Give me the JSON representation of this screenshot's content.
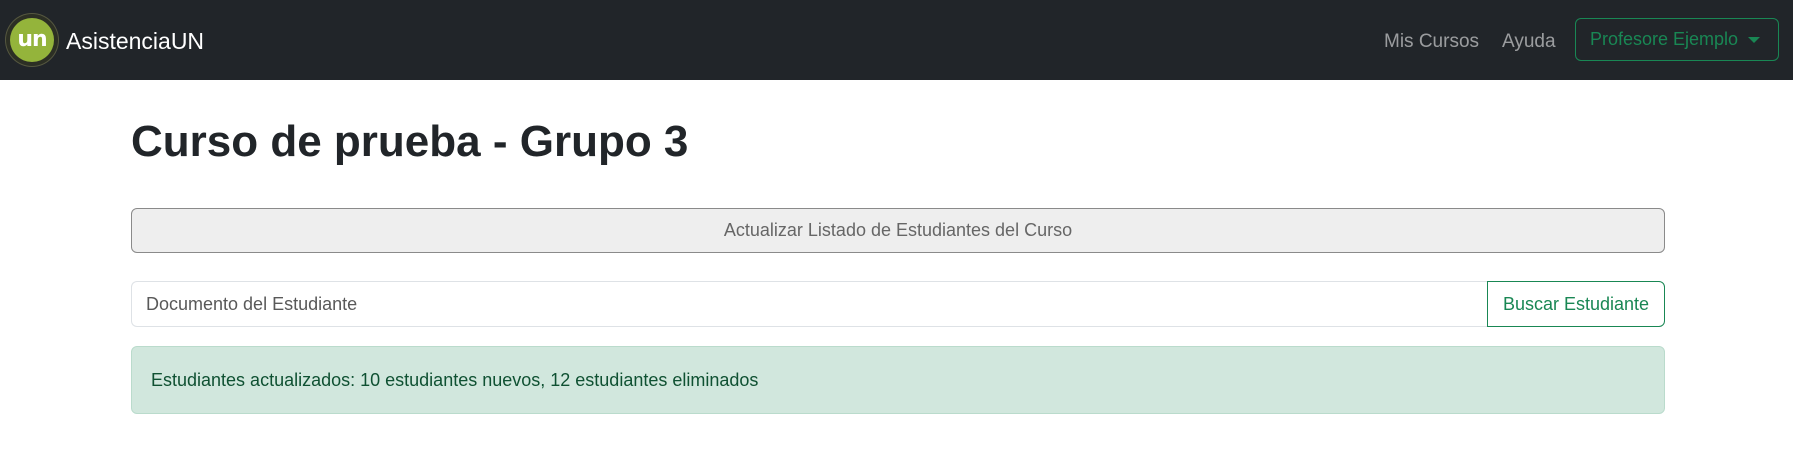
{
  "navbar": {
    "logo_text": "un",
    "brand": "AsistenciaUN",
    "links": [
      {
        "label": "Mis Cursos"
      },
      {
        "label": "Ayuda"
      }
    ],
    "user_menu_label": "Profesore Ejemplo"
  },
  "main": {
    "title": "Curso de prueba - Grupo 3",
    "update_button_label": "Actualizar Listado de Estudiantes del Curso",
    "search": {
      "placeholder": "Documento del Estudiante",
      "value": "",
      "button_label": "Buscar Estudiante"
    },
    "alert_message": "Estudiantes actualizados: 10 estudiantes nuevos, 12 estudiantes eliminados"
  },
  "colors": {
    "navbar_bg": "#212529",
    "accent_green": "#198754",
    "alert_bg": "#d1e7dd",
    "alert_text": "#0f5132",
    "logo_green": "#94b43b"
  }
}
